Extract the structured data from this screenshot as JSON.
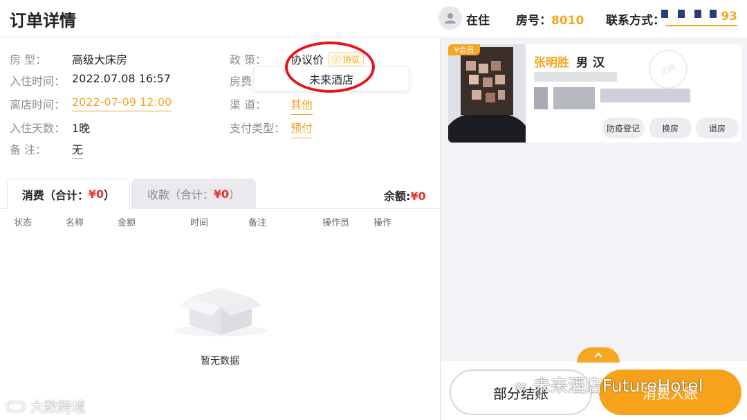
{
  "header": {
    "title": "订单详情",
    "status": "在住",
    "room_label": "房号：",
    "room_number": "8010",
    "contact_label": "联系方式：",
    "contact_value_suffix": "93"
  },
  "order_info": {
    "room_type_label": "房    型：",
    "room_type": "高级大床房",
    "checkin_label": "入住时间：",
    "checkin": "2022.07.08 16:57",
    "checkout_label": "离店时间：",
    "checkout": "2022-07-09 12:00",
    "nights_label": "入住天数：",
    "nights": "1晚",
    "remark_label": "备    注：",
    "remark": "无",
    "policy_label": "政    策：",
    "policy": "协议价",
    "policy_badge": "协议",
    "room_fee_label": "房费",
    "channel_label": "渠    道：",
    "channel": "其他",
    "pay_type_label": "支付类型：",
    "pay_type": "预付",
    "tooltip": "未来酒店"
  },
  "tabs": {
    "consume_label": "消费（合计：",
    "consume_amount": "¥0",
    "receive_label": "收款（合计：",
    "receive_amount": "¥0",
    "close_paren": "）",
    "balance_label": "余额:",
    "balance_amount": "¥0"
  },
  "table": {
    "headers": [
      "状态",
      "名称",
      "金额",
      "时间",
      "备注",
      "操作员",
      "操作"
    ],
    "empty_text": "暂无数据"
  },
  "guest": {
    "member_tag": "会员",
    "name": "张明胜",
    "sex": "男",
    "nation": "汉",
    "stamp": "无码",
    "buttons": [
      "防疫登记",
      "换房",
      "退房"
    ]
  },
  "bottom": {
    "partial_checkout": "部分结账",
    "checkout": "消费入账"
  },
  "watermarks": {
    "future_hotel": "未来酒店FutureHotel",
    "dashu": "大数跨境"
  },
  "colors": {
    "accent": "#f5a623",
    "amount_red": "#e8342c",
    "annotation_red": "#e8141c"
  }
}
